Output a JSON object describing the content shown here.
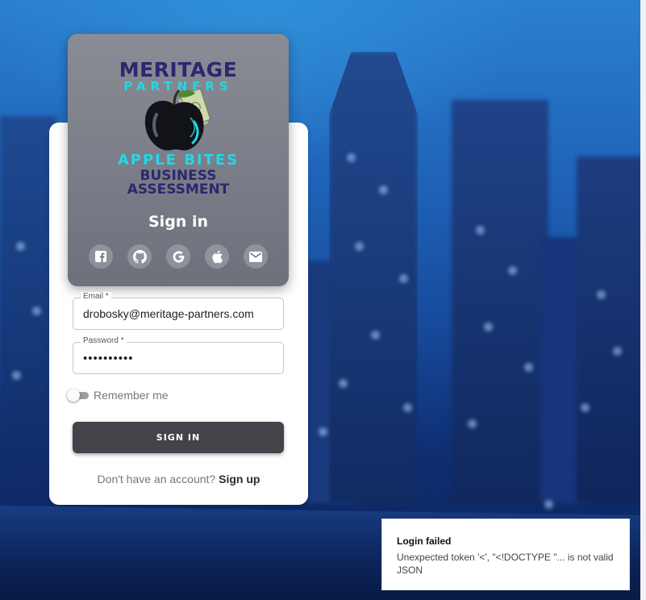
{
  "logo": {
    "title": "MERITAGE",
    "subtitle": "PARTNERS",
    "tagline_1": "APPLE BITES",
    "tagline_2": "BUSINESS",
    "tagline_3": "ASSESSMENT"
  },
  "header": {
    "title": "Sign in",
    "social": [
      {
        "icon": "facebook-icon"
      },
      {
        "icon": "github-icon"
      },
      {
        "icon": "google-icon"
      },
      {
        "icon": "apple-icon"
      },
      {
        "icon": "email-icon"
      }
    ]
  },
  "form": {
    "email": {
      "label": "Email *",
      "value": "drobosky@meritage-partners.com"
    },
    "password": {
      "label": "Password *",
      "value": "••••••••••"
    },
    "remember": {
      "label": "Remember me",
      "checked": false
    },
    "submit_label": "SIGN IN"
  },
  "signup": {
    "prompt": "Don't have an account?",
    "link": "Sign up"
  },
  "toast": {
    "title": "Login failed",
    "message": "Unexpected token '<', \"<!DOCTYPE \"... is not valid JSON"
  },
  "colors": {
    "header_bg": "#777a84",
    "button_bg": "#45434a",
    "logo_cyan": "#25d6e8",
    "logo_navy": "#2b2770"
  }
}
